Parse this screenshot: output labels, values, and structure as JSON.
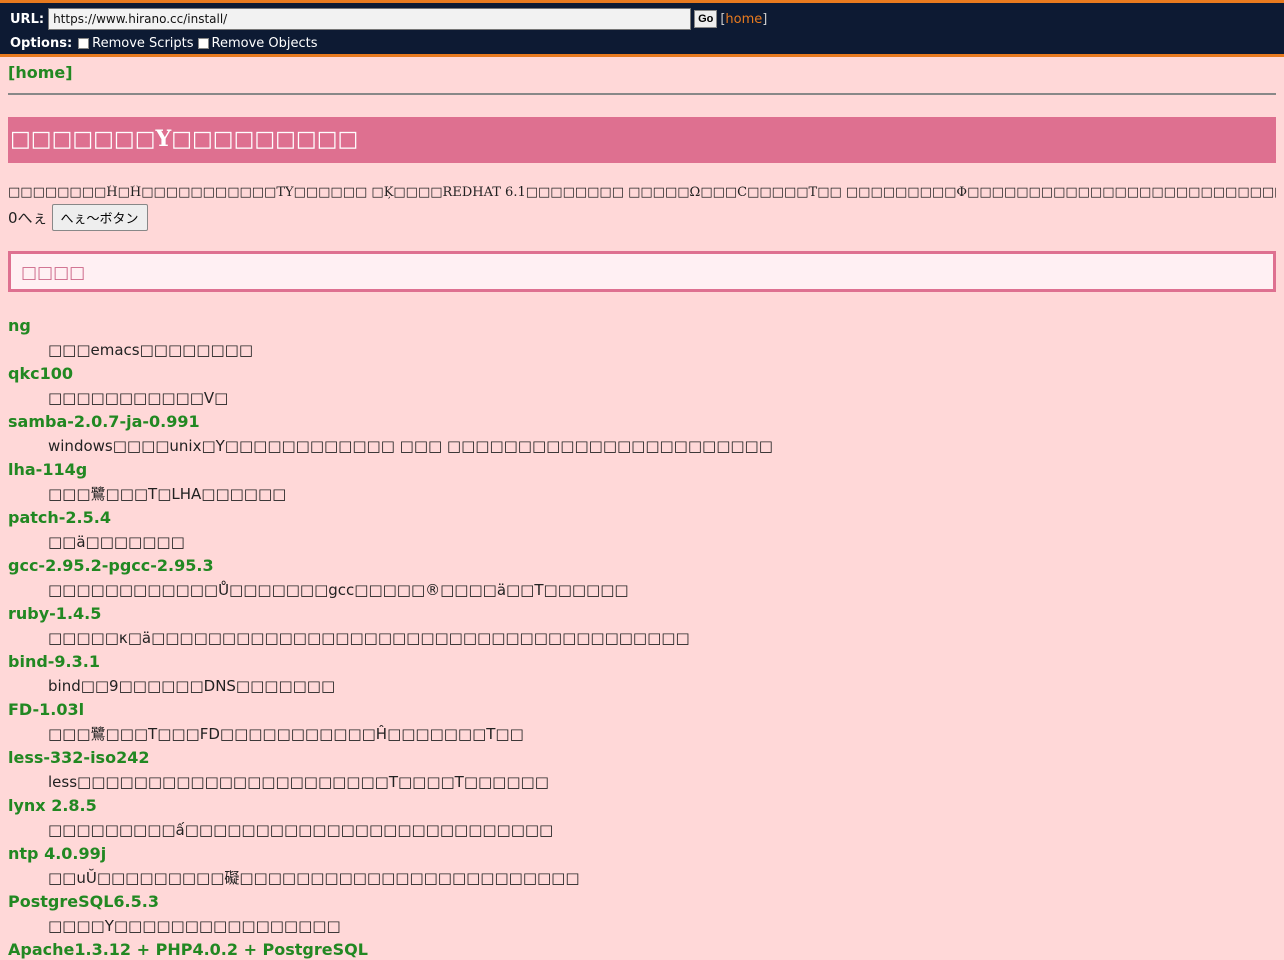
{
  "proxybar": {
    "url_label": "URL:",
    "url_value": "https://www.hirano.cc/install/",
    "go_label": "Go",
    "home_link": "home",
    "options_label": "Options:",
    "option_remove_scripts": "Remove Scripts",
    "option_remove_objects": "Remove Objects"
  },
  "page": {
    "home_link": "[home]",
    "banner_title": "□□□□□□□Y□□□□□□□□□",
    "description": "□□□□□□□□Ĥ□Ĥ□□□□□□□□□□□TY□□□□□□ □Ķ□□□□REDHAT 6.1□□□□□□□□ □□□□□Ω□□□C□□□□□T□□ □□□□□□□□□Φ□□□□□□□□□□□□□□□□□□□□□□□□□□□□T□□",
    "hee_count": "0へぇ",
    "hee_button": "へぇ〜ボタン",
    "section_heading": "□□□□"
  },
  "items": [
    {
      "name": "ng",
      "desc": "□□□emacs□□□□□□□□"
    },
    {
      "name": "qkc100",
      "desc": "□□□□□□□□□□□V□"
    },
    {
      "name": "samba-2.0.7-ja-0.991",
      "desc": "windows□□□□unix□Y□□□□□□□□□□□□ □□□ □□□□□□□□□□□□□□□□□□□□□□□"
    },
    {
      "name": "lha-114g",
      "desc": "□□□鷺□□□T□LHA□□□□□□"
    },
    {
      "name": "patch-2.5.4",
      "desc": "□□ä□□□□□□□"
    },
    {
      "name": "gcc-2.95.2-pgcc-2.95.3",
      "desc": "□□□□□□□□□□□□Ů□□□□□□□gcc□□□□□®□□□□ä□□T□□□□□□"
    },
    {
      "name": "ruby-1.4.5",
      "desc": "□□□□□κ□ä□□□□□□□□□□□□□□□□□□□□□□□□□□□□□□□□□□□□□□"
    },
    {
      "name": "bind-9.3.1",
      "desc": "bind□□9□□□□□□DNS□□□□□□□"
    },
    {
      "name": "FD-1.03l",
      "desc": "□□□鷺□□□T□□□FD□□□□□□□□□□□Ĥ□□□□□□□T□□"
    },
    {
      "name": "less-332-iso242",
      "desc": "less□□□□□□□□□□□□□□□□□□□□□□T□□□□T□□□□□□"
    },
    {
      "name": "lynx 2.8.5",
      "desc": "□□□□□□□□□ấ□□□□□□□□□□□□□□□□□□□□□□□□□□"
    },
    {
      "name": "ntp 4.0.99j",
      "desc": "□□uŬ□□□□□□□□□礙□□□□□□□□□□□□□□□□□□□□□□□□"
    },
    {
      "name": "PostgreSQL6.5.3",
      "desc": "□□□□Y□□□□□□□□□□□□□□□□"
    },
    {
      "name": "Apache1.3.12 + PHP4.0.2 + PostgreSQL",
      "desc": ""
    }
  ]
}
